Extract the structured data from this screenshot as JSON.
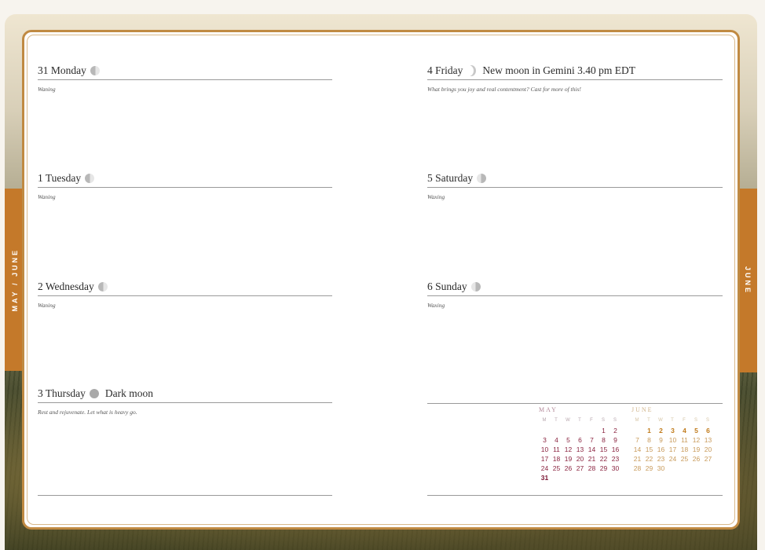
{
  "tabs": {
    "left": "MAY / JUNE",
    "right": "JUNE"
  },
  "left_page": {
    "days": [
      {
        "date": "31 Monday",
        "moon": "waning-moon-icon",
        "event": "",
        "note": "Waning"
      },
      {
        "date": "1 Tuesday",
        "moon": "waning-moon-icon",
        "event": "",
        "note": "Waning"
      },
      {
        "date": "2 Wednesday",
        "moon": "waning-moon-icon",
        "event": "",
        "note": "Waning"
      },
      {
        "date": "3 Thursday",
        "moon": "dark-moon-icon",
        "event": "Dark moon",
        "note": "Rest and rejuvenate. Let what is heavy go."
      }
    ]
  },
  "right_page": {
    "days": [
      {
        "date": "4 Friday",
        "moon": "new-moon-icon",
        "event": "New moon in Gemini 3.40 pm EDT",
        "note": "What brings you joy and real contentment? Cast for more of this!"
      },
      {
        "date": "5 Saturday",
        "moon": "waxing-moon-icon",
        "event": "",
        "note": "Waxing"
      },
      {
        "date": "6 Sunday",
        "moon": "waxing-moon-icon",
        "event": "",
        "note": "Waxing"
      }
    ]
  },
  "mini_calendars": {
    "may": {
      "title": "MAY",
      "dow": [
        "M",
        "T",
        "W",
        "T",
        "F",
        "S",
        "S"
      ],
      "weeks": [
        [
          "",
          "",
          "",
          "",
          "",
          "1",
          "2"
        ],
        [
          "3",
          "4",
          "5",
          "6",
          "7",
          "8",
          "9"
        ],
        [
          "10",
          "11",
          "12",
          "13",
          "14",
          "15",
          "16"
        ],
        [
          "17",
          "18",
          "19",
          "20",
          "21",
          "22",
          "23"
        ],
        [
          "24",
          "25",
          "26",
          "27",
          "28",
          "29",
          "30"
        ],
        [
          "31",
          "",
          "",
          "",
          "",
          "",
          ""
        ]
      ],
      "highlight": [
        "31"
      ]
    },
    "june": {
      "title": "JUNE",
      "dow": [
        "M",
        "T",
        "W",
        "T",
        "F",
        "S",
        "S"
      ],
      "weeks": [
        [
          "",
          "1",
          "2",
          "3",
          "4",
          "5",
          "6"
        ],
        [
          "7",
          "8",
          "9",
          "10",
          "11",
          "12",
          "13"
        ],
        [
          "14",
          "15",
          "16",
          "17",
          "18",
          "19",
          "20"
        ],
        [
          "21",
          "22",
          "23",
          "24",
          "25",
          "26",
          "27"
        ],
        [
          "28",
          "29",
          "30",
          "",
          "",
          "",
          ""
        ]
      ],
      "highlight": [
        "1",
        "2",
        "3",
        "4",
        "5",
        "6"
      ]
    }
  },
  "colors": {
    "accent_tab": "#c4792a",
    "frame": "#c08a42",
    "may_numbers": "#8a2440",
    "june_numbers": "#c89a5a"
  }
}
